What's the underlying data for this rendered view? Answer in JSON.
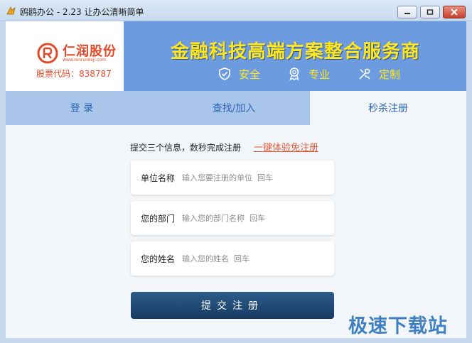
{
  "window": {
    "title": "鸥鸥办公 - 2.23 让办公清晰简单"
  },
  "banner": {
    "logo_text": "仁润股份",
    "logo_sub": "www.renrunkeji.com",
    "stock_code": "股票代码：838787",
    "slogan": "金融科技高端方案整合服务商",
    "features": [
      {
        "label": "安全",
        "icon": "shield-check-icon"
      },
      {
        "label": "专业",
        "icon": "medal-icon"
      },
      {
        "label": "定制",
        "icon": "tools-icon"
      }
    ]
  },
  "tabs": [
    {
      "label": "登 录"
    },
    {
      "label": "查找/加入"
    },
    {
      "label": "秒杀注册",
      "active": true
    }
  ],
  "form": {
    "hint": "提交三个信息，数秒完成注册",
    "quick_link": "一键体验免注册",
    "fields": [
      {
        "label": "单位名称",
        "placeholder": "输入您要注册的单位  回车"
      },
      {
        "label": "您的部门",
        "placeholder": "输入您的部门名称  回车"
      },
      {
        "label": "您的姓名",
        "placeholder": "输入您的姓名  回车"
      }
    ],
    "submit": "提交注册"
  },
  "watermark": "极速下载站",
  "colors": {
    "banner_bg": "#6d9be0",
    "slogan": "#ffe71c",
    "brand_red": "#e24a2a",
    "tab_bar": "#aac5ea",
    "tab_text": "#2b67b5",
    "submit_bg": "#1f4a75",
    "link": "#e25b3b"
  }
}
